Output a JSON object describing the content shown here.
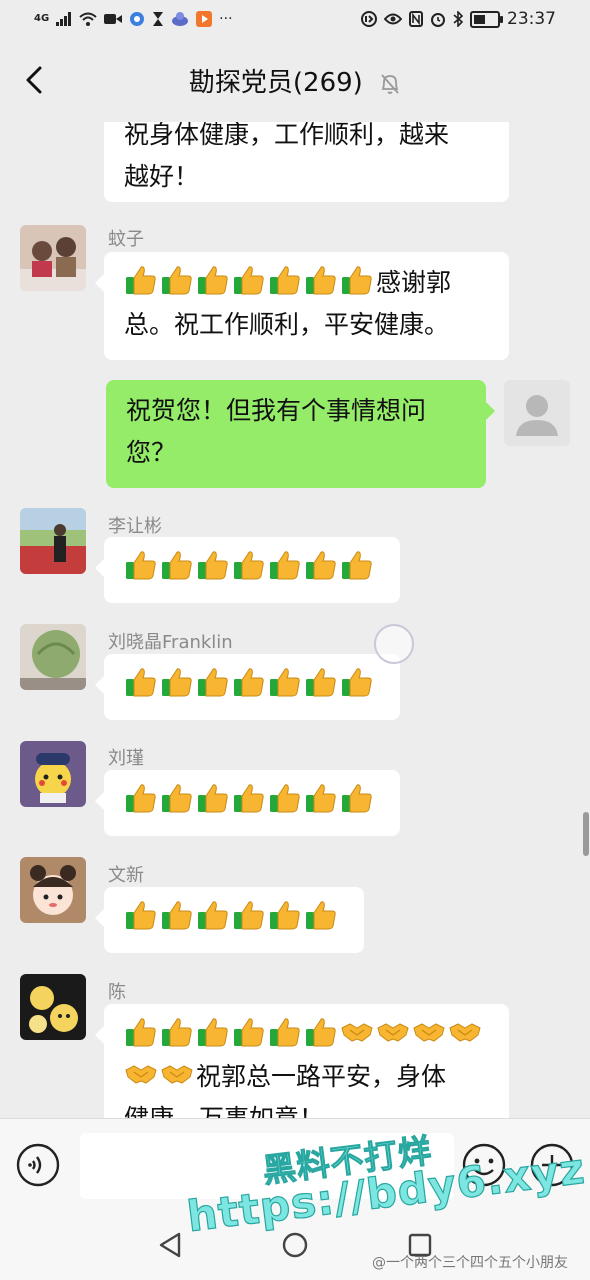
{
  "status_bar": {
    "network_label": "4G",
    "time": "23:37",
    "battery_percent": 50
  },
  "header": {
    "title": "勘探党员(269)"
  },
  "messages": {
    "m0": {
      "line1": "祝身体健康，工作顺利，越来",
      "line2": "越好！"
    },
    "m1": {
      "sender": "蚊子",
      "thumbs": 7,
      "text1": "感谢郭",
      "line2": "总。祝工作顺利，平安健康。"
    },
    "m2": {
      "line1": "祝贺您！但我有个事情想问",
      "line2": "您？"
    },
    "m3": {
      "sender": "李让彬",
      "thumbs": 7
    },
    "m4": {
      "sender": "刘晓晶Franklin",
      "thumbs": 7
    },
    "m5": {
      "sender": "刘瑾",
      "thumbs": 7
    },
    "m6": {
      "sender": "文新",
      "thumbs": 6
    },
    "m7": {
      "sender": "陈",
      "thumbs": 6,
      "handshakes": 6,
      "text2": "祝郭总一路平安，身体",
      "line3": "健康，万事如意！"
    }
  },
  "watermark": {
    "line1": "黑料不打烊",
    "line2": "https://bdy6.xyz",
    "credit": "@一个两个三个四个五个小朋友"
  },
  "colors": {
    "background": "#ededed",
    "bubble_self": "#95ec69",
    "bubble_other": "#ffffff",
    "thumb": "#f7b531",
    "cuff": "#24a839",
    "watermark": "#7ee6e1"
  }
}
